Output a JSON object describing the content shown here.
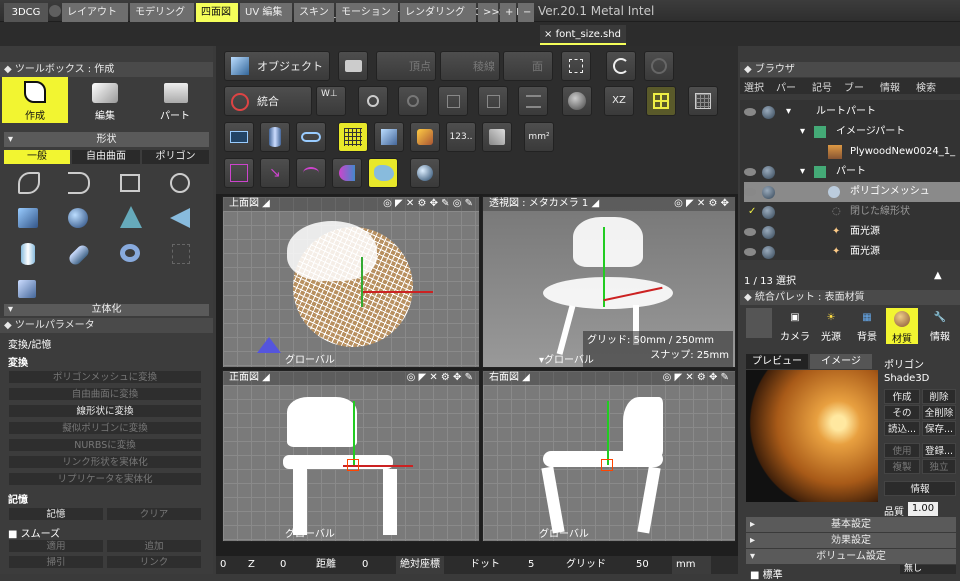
{
  "window": {
    "title": "font_size.shd — Shade3D Professional Ver.20.1 Metal Intel"
  },
  "tabs": {
    "mode": "3DCG",
    "items": [
      "レイアウト",
      "モデリング",
      "四面図",
      "UV 編集",
      "スキン",
      "モーション",
      "レンダリング",
      ">>",
      "+",
      "−"
    ],
    "active": "四面図",
    "doc_tab": "font_size.shd",
    "doc_close": "×"
  },
  "toolbox": {
    "header": "ツールボックス : 作成",
    "big": [
      "作成",
      "編集",
      "パート"
    ],
    "shape_header": "形状",
    "shape_tabs": [
      "一般",
      "自由曲面",
      "ポリゴン"
    ],
    "solid_header": "立体化"
  },
  "params": {
    "header": "ツールパラメータ",
    "group": "変換/記憶",
    "conv_label": "変換",
    "conv_buttons": [
      "ポリゴンメッシュに変換",
      "自由曲面に変換",
      "線形状に変換",
      "擬似ポリゴンに変換",
      "NURBSに変換",
      "リンク形状を実体化",
      "リプリケータを実体化"
    ],
    "mem_label": "記憶",
    "mem_buttons": [
      "記憶",
      "クリア"
    ],
    "smooth_label": "スムーズ",
    "smooth_buttons": [
      "適用",
      "追加",
      "掃引",
      "リンク"
    ]
  },
  "toolbar": {
    "object": "オブジェクト",
    "vertex": "頂点",
    "edge": "稜線",
    "face": "面",
    "merge": "統合",
    "xz": "XZ",
    "num": "123..",
    "mm": "mm²"
  },
  "viewports": {
    "tl": "上面図",
    "tr": "透視図 : メタカメラ 1",
    "bl": "正面図",
    "br": "右面図",
    "global": "グローバル",
    "grid_info": "グリッド: 50mm / 250mm",
    "snap_info": "スナップ: 25mm"
  },
  "statusbar": {
    "items": [
      "0",
      "Z",
      "0",
      "距離",
      "0",
      "絶対座標",
      "ドット",
      "5",
      "グリッド",
      "50",
      "mm"
    ]
  },
  "browser": {
    "header": "ブラウザ",
    "menu": [
      "選択",
      "パー",
      "記号",
      "ブー",
      "情報",
      "検索"
    ],
    "tree": [
      "ルートパート",
      "イメージパート",
      "PlywoodNew0024_1_",
      "パート",
      "ポリゴンメッシュ",
      "閉じた線形状",
      "面光源",
      "面光源"
    ],
    "count": "1 / 13 選択"
  },
  "palette": {
    "header": "統合パレット : 表面材質",
    "icons": [
      "カメラ",
      "光源",
      "背景",
      "材質",
      "情報"
    ],
    "tabs": [
      "プレビュー",
      "イメージ"
    ],
    "kind": "ポリゴン",
    "name": "Shade3D",
    "buttons": [
      "作成",
      "削除",
      "その",
      "全削除",
      "読込...",
      "保存...",
      "使用",
      "登録...",
      "複製",
      "独立"
    ],
    "info": "情報",
    "quality_label": "品質",
    "quality": "1.00",
    "sections": [
      "基本設定",
      "効果設定",
      "ボリューム設定"
    ],
    "tree_opt": "■ 標準",
    "tree_opt2": "無し"
  }
}
